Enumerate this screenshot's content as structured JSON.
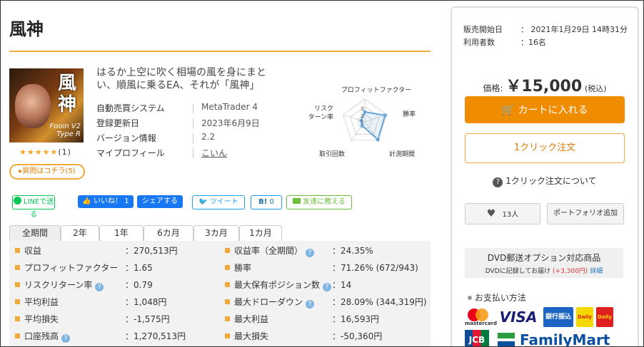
{
  "product": {
    "title": "風神",
    "thumb_title": "風神",
    "thumb_sub": "Fooin V2\nType R",
    "stars": "★★★★★",
    "review_count": "(1)",
    "question_button": "質問はコチラ(5)",
    "catchphrase": "はるか上空に吹く相場の風を身にまとい、順風に乗るEA、それが「風神」"
  },
  "info": [
    {
      "key": "自動売買システム",
      "value": "MetaTrader 4"
    },
    {
      "key": "登録更新日",
      "value": "2023年6月9日"
    },
    {
      "key": "バージョン情報",
      "value": "2.2"
    },
    {
      "key": "マイプロフィール",
      "value": "こいん"
    }
  ],
  "radar": {
    "labels": {
      "pf": "プロフィットファクター",
      "win": "勝率",
      "period": "計測期間",
      "trades": "取引回数",
      "risk": "リスクターン率"
    },
    "scale_labels": [
      "3",
      "2",
      "1"
    ],
    "values": {
      "pf": 1.3,
      "win": 2.8,
      "period": 2.9,
      "trades": 0.6,
      "risk": 0.5
    }
  },
  "social": {
    "line": "LINEで送る",
    "like": "いいね！",
    "like_count": "1",
    "share": "シェアする",
    "tweet": "ツイート",
    "hatena": "B!",
    "hatena_count": "0",
    "friend": "友達に教える"
  },
  "tabs": [
    "全期間",
    "2年",
    "1年",
    "6カ月",
    "3カ月",
    "1カ月"
  ],
  "stats_left": [
    {
      "label": "収益",
      "value": "：270,513円",
      "help": false
    },
    {
      "label": "プロフィットファクター",
      "value": "：1.65",
      "help": false
    },
    {
      "label": "リスクリターン率",
      "value": "：0.79",
      "help": true
    },
    {
      "label": "平均利益",
      "value": "：1,048円",
      "help": false
    },
    {
      "label": "平均損失",
      "value": "：-1,575円",
      "help": false
    },
    {
      "label": "口座残高",
      "value": "：1,270,513円",
      "help": true
    }
  ],
  "stats_right": [
    {
      "label": "収益率（全期間）",
      "value": "：24.35%",
      "help": true
    },
    {
      "label": "勝率",
      "value": "：71.26% (672/943)",
      "help": false
    },
    {
      "label": "最大保有ポジション数",
      "value": "：14",
      "help": true
    },
    {
      "label": "最大ドローダウン",
      "value": "：28.09% (344,319円)",
      "help": true
    },
    {
      "label": "最大利益",
      "value": "：16,593円",
      "help": false
    },
    {
      "label": "最大損失",
      "value": "：-50,360円",
      "help": false
    }
  ],
  "sidebar": {
    "sale_start_label": "販売開始日",
    "sale_start_value": "： 2021年1月29日 14時31分",
    "users_label": "利用者数",
    "users_value": "：16名",
    "price_label": "価格:",
    "price_value": "￥15,000",
    "price_tax": "(税込)",
    "cart_button": "カートに入れる",
    "oneclick_button": "1クリック注文",
    "oneclick_about": "1クリック注文について",
    "favorite_count": "13人",
    "portfolio_button": "ポートフォリオ追加",
    "dvd_title": "DVD郵送オプション対応商品",
    "dvd_desc": "DVDに記録してお届け",
    "dvd_price": "(+3,300円)",
    "dvd_detail": "詳細",
    "payment_title": "お支払い方法",
    "payments": [
      "mastercard",
      "VISA",
      "銀行振込",
      "Daily",
      "Daily",
      "JCB",
      "FamilyMart"
    ]
  },
  "colors": {
    "accent": "#f08c00",
    "stat_marker": "#f0a93a",
    "radar": "#6aa6d9",
    "line": "#06c755",
    "facebook": "#1877f2",
    "twitter": "#1da1f2"
  }
}
